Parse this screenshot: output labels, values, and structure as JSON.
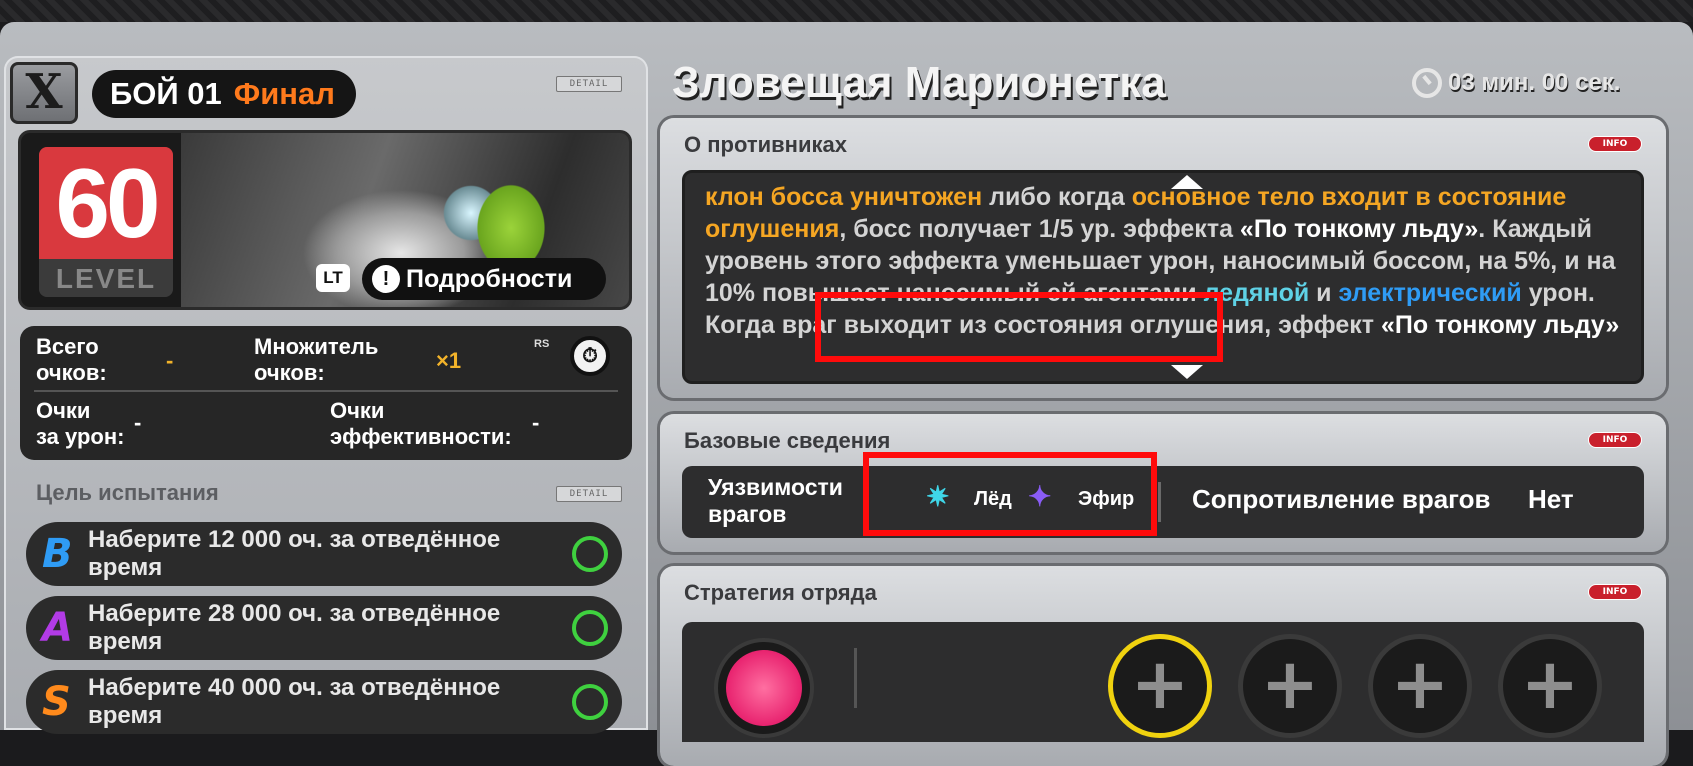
{
  "battle": {
    "label": "БОЙ 01",
    "stage": "Финал",
    "close": "X"
  },
  "boss_card": {
    "level": "60",
    "level_label": "LEVEL",
    "lt_label": "LT",
    "details_label": "Подробности",
    "details_icon": "!"
  },
  "score": {
    "total_label_1": "Всего",
    "total_label_2": "очков:",
    "total_value": "-",
    "mult_label_1": "Множитель",
    "mult_label_2": "очков:",
    "mult_value": "×1",
    "rs_label": "RS",
    "damage_label_1": "Очки",
    "damage_label_2": "за урон:",
    "damage_value": "-",
    "eff_label_1": "Очки",
    "eff_label_2": "эффективности:",
    "eff_value": "-"
  },
  "goals": {
    "title": "Цель испытания",
    "items": [
      {
        "rank": "B",
        "text": "Наберите 12 000 оч. за отведённое время",
        "color": "#2f9cf5"
      },
      {
        "rank": "A",
        "text": "Наберите 28 000 оч. за отведённое время",
        "color": "#b23be6"
      },
      {
        "rank": "S",
        "text": "Наберите 40 000 оч. за отведённое время",
        "color": "#ff8a1c"
      }
    ]
  },
  "boss": {
    "name": "Зловещая Марионетка",
    "timer": "03 мин. 00 сек."
  },
  "enemies": {
    "title": "О противниках",
    "info": "INFO",
    "p1": "клон босса уничтожен",
    "p2": " либо когда ",
    "p3": "основное тело входит в состояние оглушения",
    "p4": ", босс получает 1/5 ур. эффекта ",
    "p5": "«По тонкому льду»",
    "p6": ". Каждый уровень этого эффекта уменьшает урон, наносимый боссом, на 5%, и на 10% повышает наносимый ей агентами ",
    "p7": "ледяной",
    "p8": " и ",
    "p9": "электрический",
    "p10": " урон. Когда враг выходит из состояния оглушения, эффект ",
    "p11": "«По тонкому льду»"
  },
  "basic": {
    "title": "Базовые сведения",
    "info": "INFO",
    "weak_label": "Уязвимости врагов",
    "weak_1": "Лёд",
    "weak_2": "Эфир",
    "resist_label": "Сопротивление врагов",
    "resist_value": "Нет"
  },
  "strategy": {
    "title": "Стратегия отряда",
    "info": "INFO",
    "slot_symbol": "+"
  },
  "tag_text": "DETAIL",
  "colors": {
    "accent": "#ff7a1c",
    "level_red": "#d9393e",
    "highlight": "#ff0b0b",
    "ring": "#3fd13f",
    "slot_ring": "#f0d20f"
  }
}
